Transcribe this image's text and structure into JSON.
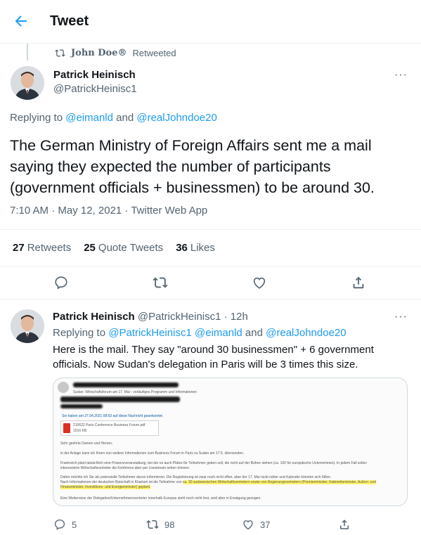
{
  "header": {
    "title": "Tweet",
    "back_icon": "arrow-left-icon"
  },
  "retweet_notice": {
    "name": "John Doe®",
    "action": "Retweeted"
  },
  "tweet1": {
    "author_name": "Patrick Heinisch",
    "author_handle": "@PatrickHeinisc1",
    "replying_prefix": "Replying to",
    "reply_to_1": "@eimanld",
    "reply_and": "and",
    "reply_to_2": "@realJohndoe20",
    "text": "The German Ministry of Foreign Affairs sent me a mail saying they expected the number of participants (government officials + businessmen) to be around 30.",
    "meta": "7:10 AM · May 12, 2021 · Twitter Web App",
    "stats": {
      "retweets_count": "27",
      "retweets_label": "Retweets",
      "quotes_count": "25",
      "quotes_label": "Quote Tweets",
      "likes_count": "36",
      "likes_label": "Likes"
    }
  },
  "tweet2": {
    "author_name": "Patrick Heinisch",
    "author_handle": "@PatrickHeinisc1 · 12h",
    "replying_prefix": "Replying to",
    "reply_to_1": "@PatrickHeinisc1",
    "reply_to_2": "@eimanld",
    "reply_and": "and",
    "reply_to_3": "@realJohndoe20",
    "text": "Here is the mail. They say \"around 30 businessmen\" + 6 government officials. Now Sudan's delegation in Paris will be 3 times this size.",
    "attachment": {
      "subject": "Sudan: Wirtschaftsforum am 17. Mai - vorläufiges Programm und Informationen",
      "notice": "Sie haben am 27.04.2021 08:53 auf diese Nachricht geantwortet.",
      "file_name": "210622 Paris Conference Business Forum.pdf",
      "file_size": "1516 KB",
      "greeting": "Sehr geehrte Damen und Herren,",
      "p1": "in der Anlage kann ich Ihnen nun weitere Informationen zum Business Forum in Paris zu Sudan am 17.5. übersenden.",
      "p2a": "Frankreich plant tatsächlich eine Präsenzveranstaltung, bei der es auch Plätze für Teilnehmer geben soll, die nicht auf der Bühne stehen (ca. 100 für europäische Unternehmen). In jedem Fall sollen",
      "p2b": "interessierte Wirtschaftsvertreter die Konferenz aber per Livestream sehen können.",
      "p3a": "Daher möchte ich Sie als potenzielle Teilnehmer davon informieren. Die Registrierung ist zwar noch nicht offen, aber der 17. Mai rückt näher und Kalender könnten sich füllen.",
      "p3b": "Nach Informationen der deutschen Botschaft in Khartum ist die Teilnahme von ca. 30 sudanesischen Wirtschaftsvertretern sowie von Regierungsvertretern (Premierminister, Kabinettsminister, Außen- und",
      "p3c": "Finanzminister, Investitions- und Energieminister) geplant.",
      "p4": "Eine Weiterreise der Delegation/Unternehmensvertreter innerhalb Europas steht noch nicht fest, wird aber in Erwägung gezogen."
    },
    "actions": {
      "replies": "5",
      "retweets": "98",
      "likes": "37"
    }
  },
  "colors": {
    "accent": "#1d9bf0",
    "text": "#0f1419",
    "muted": "#536471",
    "border": "#eff3f4",
    "highlight": "#fff36b"
  }
}
